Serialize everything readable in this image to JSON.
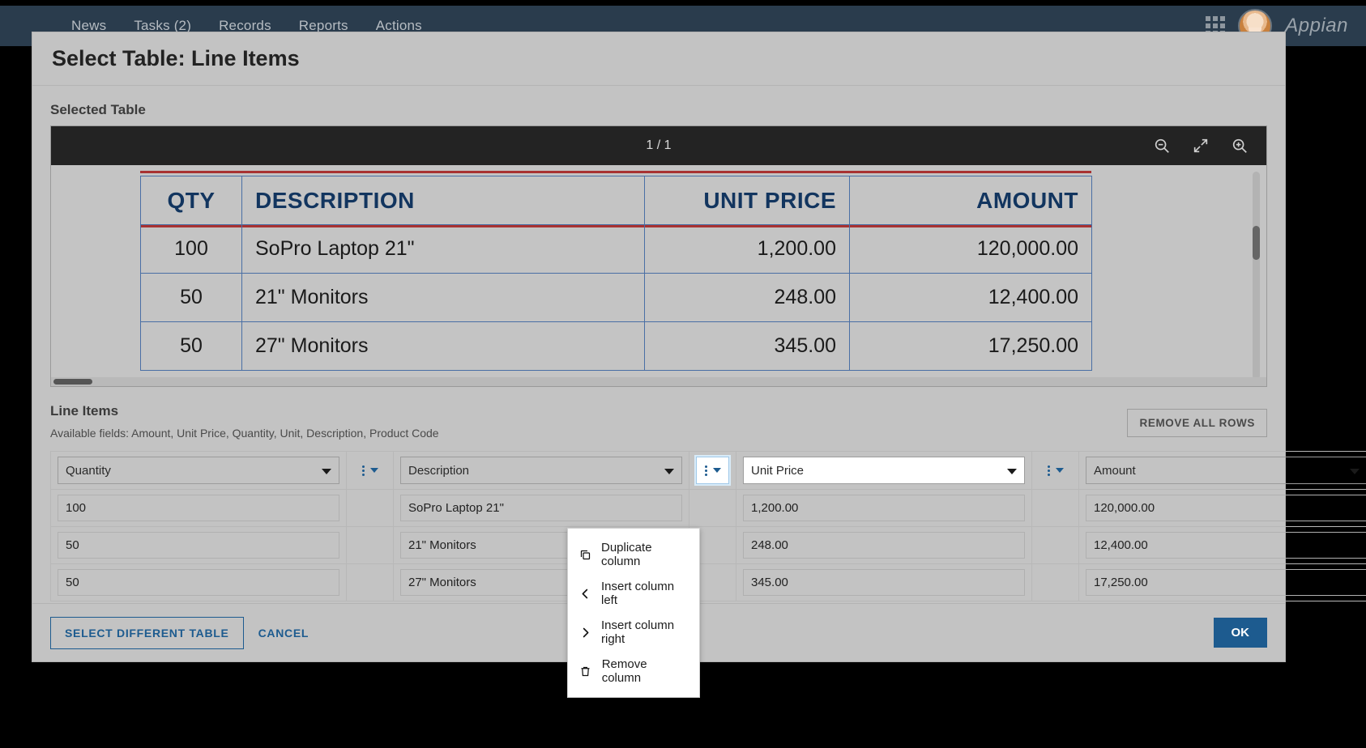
{
  "topnav": {
    "items": [
      {
        "label": "News"
      },
      {
        "label": "Tasks (2)"
      },
      {
        "label": "Records"
      },
      {
        "label": "Reports"
      },
      {
        "label": "Actions"
      }
    ],
    "brand": "Appian",
    "grid_icon": "grid-apps-icon",
    "avatar": "user-avatar"
  },
  "modal": {
    "title": "Select Table: Line Items",
    "selected_table_label": "Selected Table",
    "viewer": {
      "page_indicator": "1 / 1",
      "tools": [
        {
          "name": "zoom-out-icon"
        },
        {
          "name": "expand-icon"
        },
        {
          "name": "zoom-in-icon"
        }
      ],
      "document_table": {
        "headers": [
          "QTY",
          "DESCRIPTION",
          "UNIT PRICE",
          "AMOUNT"
        ],
        "rows": [
          [
            "100",
            "SoPro Laptop 21\"",
            "1,200.00",
            "120,000.00"
          ],
          [
            "50",
            "21\" Monitors",
            "248.00",
            "12,400.00"
          ],
          [
            "50",
            "27\" Monitors",
            "345.00",
            "17,250.00"
          ]
        ]
      }
    },
    "line_items": {
      "title": "Line Items",
      "available_fields": "Available fields: Amount, Unit Price, Quantity, Unit, Description, Product Code",
      "remove_all_label": "REMOVE ALL ROWS",
      "columns": [
        {
          "field": "Quantity"
        },
        {
          "field": "Description"
        },
        {
          "field": "Unit Price"
        },
        {
          "field": "Amount"
        }
      ],
      "rows": [
        {
          "quantity": "100",
          "description": "SoPro Laptop 21\"",
          "unit_price": "1,200.00",
          "amount": "120,000.00"
        },
        {
          "quantity": "50",
          "description": "21\" Monitors",
          "unit_price": "248.00",
          "amount": "12,400.00"
        },
        {
          "quantity": "50",
          "description": "27\" Monitors",
          "unit_price": "345.00",
          "amount": "17,250.00"
        }
      ]
    },
    "context_menu": {
      "items": [
        {
          "label": "Duplicate column",
          "icon": "duplicate-icon"
        },
        {
          "label": "Insert column left",
          "icon": "chevron-left-icon"
        },
        {
          "label": "Insert column right",
          "icon": "chevron-right-icon"
        },
        {
          "label": "Remove column",
          "icon": "trash-icon"
        }
      ]
    },
    "footer": {
      "select_different_table": "SELECT DIFFERENT TABLE",
      "cancel": "CANCEL",
      "ok": "OK"
    }
  },
  "colors": {
    "nav_bg": "#2a3c4d",
    "accent": "#1d5b8f",
    "danger": "#b02020",
    "doc_header_text": "#12355f",
    "doc_rule": "#a83232"
  }
}
